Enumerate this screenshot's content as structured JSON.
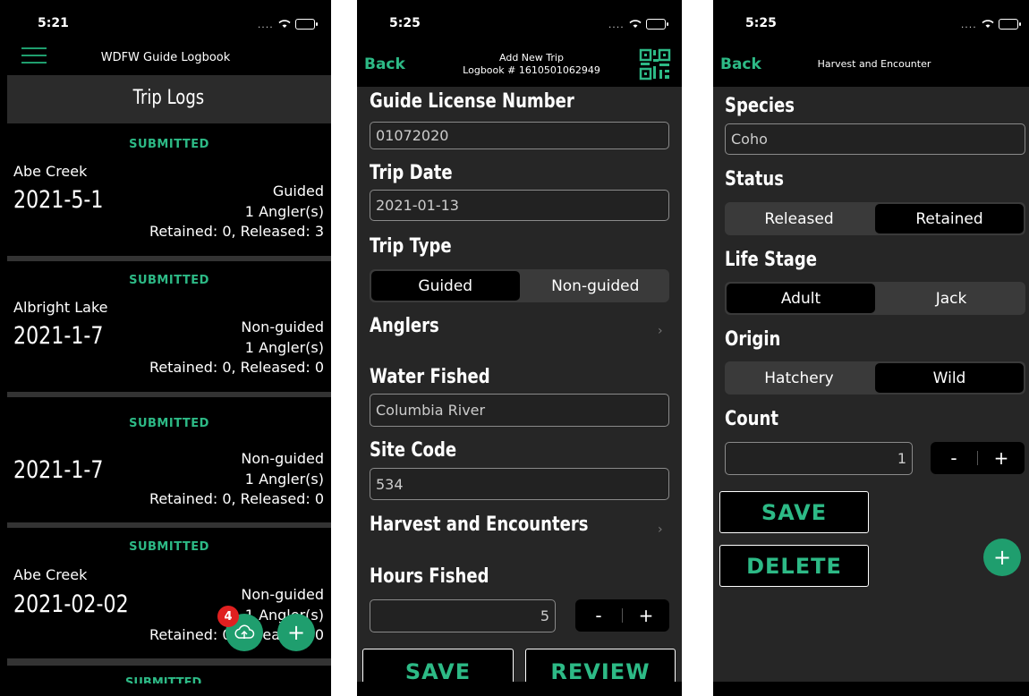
{
  "screen1": {
    "time": "5:21",
    "signal": "....",
    "header_title": "WDFW Guide Logbook",
    "section_title": "Trip Logs",
    "trips": [
      {
        "status": "SUBMITTED",
        "site": "Abe Creek",
        "date": "2021-5-1",
        "type": "Guided",
        "anglers": "1 Angler(s)",
        "counts": "Retained: 0,  Released: 3"
      },
      {
        "status": "SUBMITTED",
        "site": "Albright Lake",
        "date": "2021-1-7",
        "type": "Non-guided",
        "anglers": "1 Angler(s)",
        "counts": "Retained: 0,  Released: 0"
      },
      {
        "status": "SUBMITTED",
        "site": "",
        "date": "2021-1-7",
        "type": "Non-guided",
        "anglers": "1 Angler(s)",
        "counts": "Retained: 0,  Released: 0"
      },
      {
        "status": "SUBMITTED",
        "site": "Abe Creek",
        "date": "2021-02-02",
        "type": "Non-guided",
        "anglers": "1 Angler(s)",
        "counts": "Retained: 0,  Released: 0"
      }
    ],
    "upload_badge": "4",
    "colors": {
      "accent": "#2dba86",
      "badge": "#e02020"
    }
  },
  "screen2": {
    "time": "5:25",
    "signal": "....",
    "back": "Back",
    "title": "Add New Trip",
    "subtitle": "Logbook # 1610501062949",
    "license_label": "Guide License Number",
    "license_value": "01072020",
    "date_label": "Trip Date",
    "date_value": "2021-01-13",
    "type_label": "Trip Type",
    "type_options": [
      "Guided",
      "Non-guided"
    ],
    "anglers_label": "Anglers",
    "water_label": "Water Fished",
    "water_value": "Columbia River",
    "site_label": "Site Code",
    "site_value": "534",
    "harvest_label": "Harvest and Encounters",
    "hours_label": "Hours Fished",
    "hours_value": "5",
    "minus": "-",
    "plus": "+",
    "save": "SAVE",
    "review": "REVIEW"
  },
  "screen3": {
    "time": "5:25",
    "signal": "....",
    "back": "Back",
    "title": "Harvest and Encounter",
    "species_label": "Species",
    "species_value": "Coho",
    "status_label": "Status",
    "status_options": [
      "Released",
      "Retained"
    ],
    "life_label": "Life Stage",
    "life_options": [
      "Adult",
      "Jack"
    ],
    "origin_label": "Origin",
    "origin_options": [
      "Hatchery",
      "Wild"
    ],
    "count_label": "Count",
    "count_value": "1",
    "minus": "-",
    "plus": "+",
    "save": "SAVE",
    "delete": "DELETE"
  }
}
